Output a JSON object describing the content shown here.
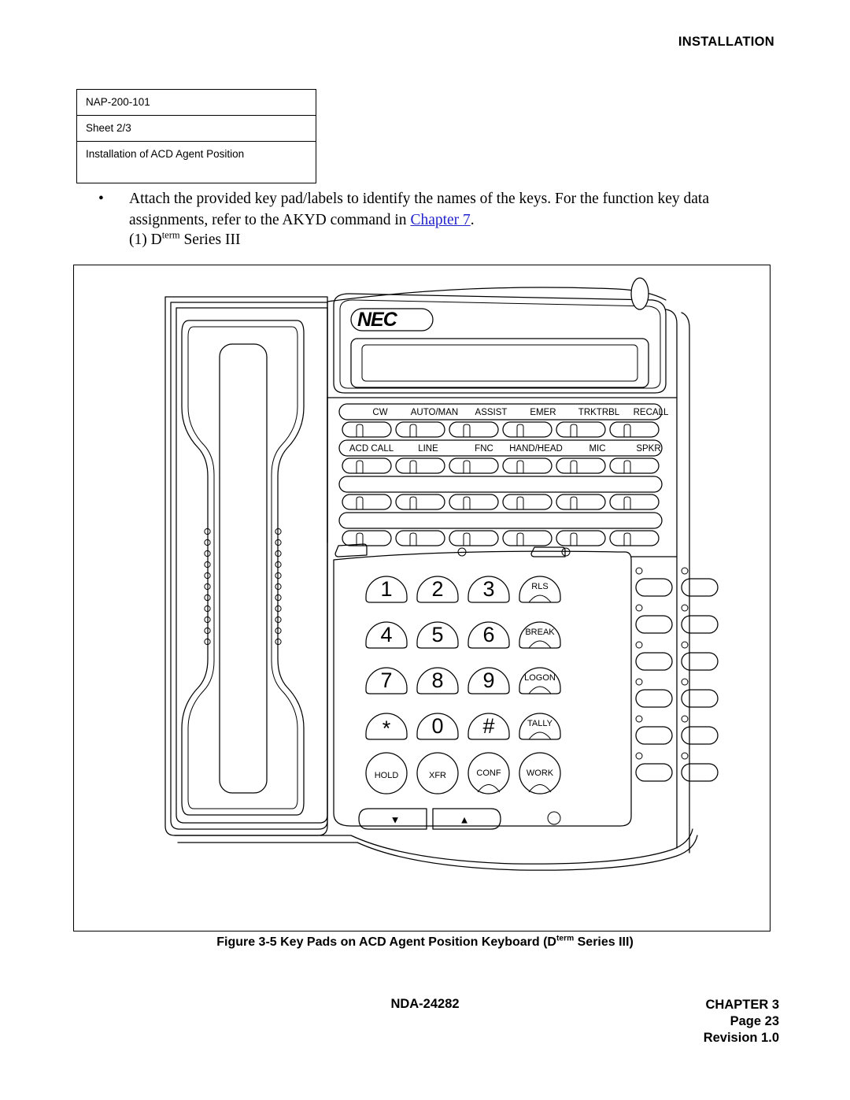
{
  "header": {
    "section_title": "INSTALLATION"
  },
  "nap_table": {
    "rows": [
      "NAP-200-101",
      "Sheet 2/3",
      "Installation of ACD Agent Position"
    ]
  },
  "body": {
    "bullet_marker": "•",
    "bullet_text_part1": "Attach the provided key pad/labels to identify the names of the keys. For the function key data assignments, refer to the AKYD command in ",
    "bullet_link": "Chapter 7",
    "bullet_text_part2": ".",
    "subitem_prefix": "(1)  D",
    "subitem_superscript": "term",
    "subitem_suffix": " Series III"
  },
  "figure": {
    "caption_prefix": "Figure 3-5   Key Pads on ACD Agent Position Keyboard (D",
    "caption_superscript": "term",
    "caption_suffix": " Series III)",
    "brand": "NEC",
    "function_keys_row1": [
      "CW",
      "AUTO/MAN",
      "ASSIST",
      "EMER",
      "TRKTRBL",
      "RECALL"
    ],
    "function_keys_row2": [
      "ACD CALL",
      "LINE",
      "FNC",
      "HAND/HEAD",
      "MIC",
      "SPKR"
    ],
    "function_keys_row3": [
      "",
      "",
      "",
      "",
      "",
      ""
    ],
    "function_keys_row4": [
      "",
      "",
      "",
      "",
      "",
      ""
    ],
    "keypad_rows": [
      [
        "1",
        "2",
        "3",
        "RLS"
      ],
      [
        "4",
        "5",
        "6",
        "BREAK"
      ],
      [
        "7",
        "8",
        "9",
        "LOGON"
      ],
      [
        "*",
        "0",
        "#",
        "TALLY"
      ],
      [
        "HOLD",
        "XFR",
        "CONF",
        "WORK"
      ]
    ],
    "volume_down_icon": "▼",
    "volume_up_icon": "▲"
  },
  "footer": {
    "document_number": "NDA-24282",
    "chapter": "CHAPTER 3",
    "page": "Page 23",
    "revision": "Revision 1.0"
  }
}
